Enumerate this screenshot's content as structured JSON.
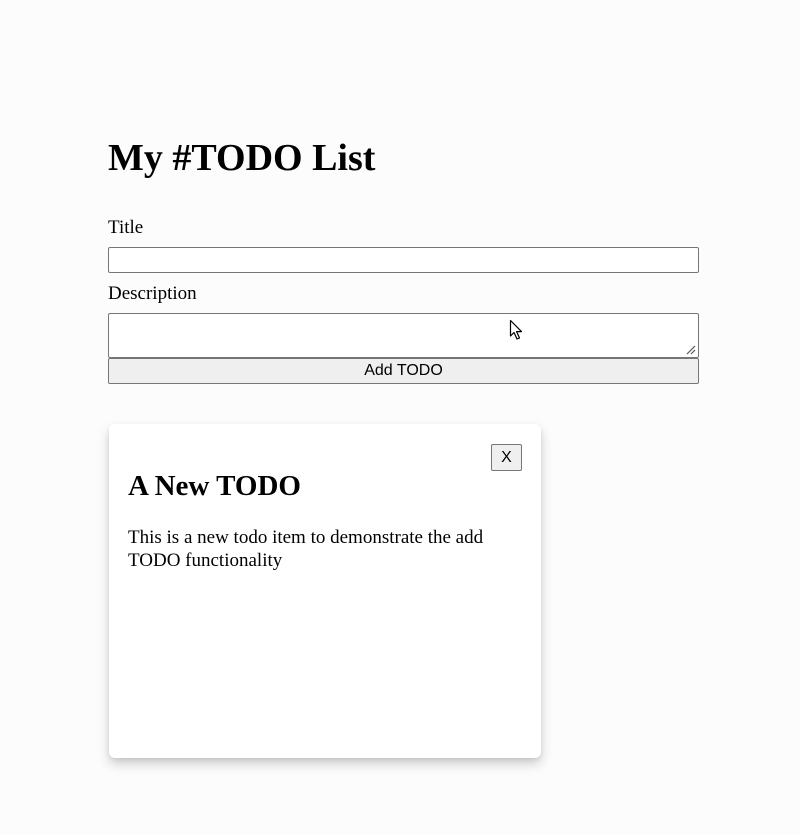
{
  "page": {
    "title": "My #TODO List"
  },
  "form": {
    "title_label": "Title",
    "title_value": "",
    "description_label": "Description",
    "description_value": "",
    "add_button_label": "Add TODO"
  },
  "todos": [
    {
      "title": "A New TODO",
      "description": "This is a new todo item to demonstrate the add TODO functionality",
      "close_label": "X"
    }
  ],
  "icons": {
    "cursor": "mouse-pointer-icon",
    "resize": "resize-grip-icon"
  }
}
